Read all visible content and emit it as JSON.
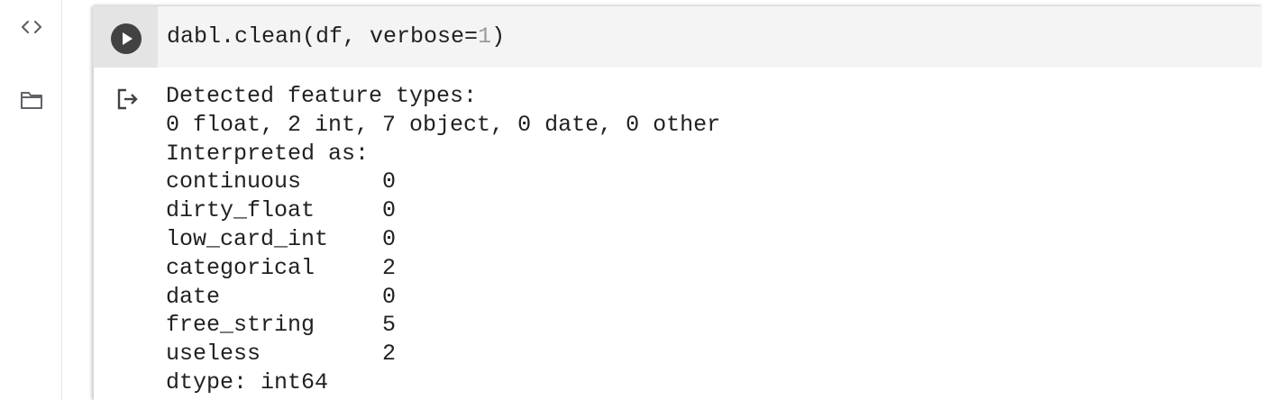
{
  "sidebar": {
    "items": [
      {
        "name": "code-snippets",
        "icon": "code-brackets-icon"
      },
      {
        "name": "files",
        "icon": "folder-icon"
      }
    ]
  },
  "cell": {
    "code": {
      "prefix": "dabl.clean(df, verbose=",
      "number": "1",
      "suffix": ")"
    },
    "output": {
      "icon": "output-redirect-icon",
      "lines": [
        "Detected feature types:",
        "0 float, 2 int, 7 object, 0 date, 0 other",
        "Interpreted as:",
        "continuous      0",
        "dirty_float     0",
        "low_card_int    0",
        "categorical     2",
        "date            0",
        "free_string     5",
        "useless         2",
        "dtype: int64"
      ]
    }
  },
  "colors": {
    "run_button": "#424242",
    "code_background": "#f4f4f4",
    "gutter_background": "#e4e4e4",
    "text": "#212121",
    "number_literal": "#9a9a9a"
  }
}
